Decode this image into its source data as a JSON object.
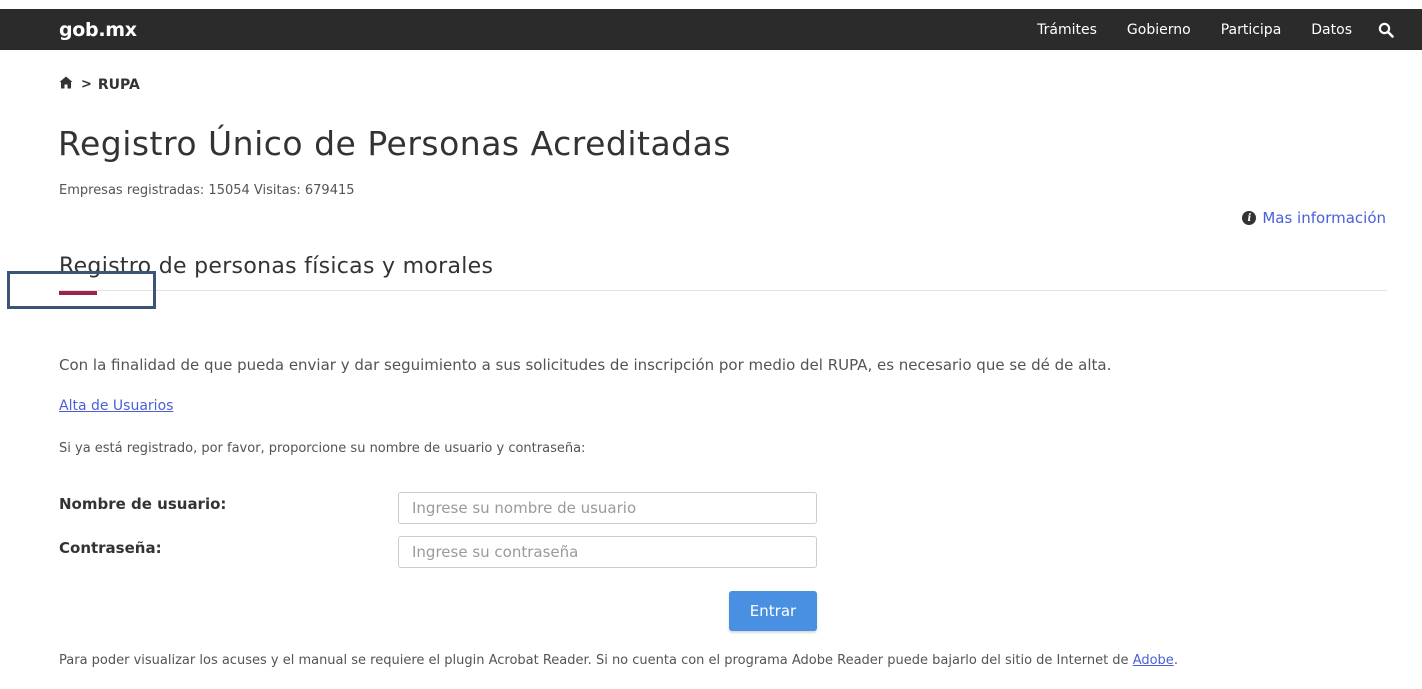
{
  "header": {
    "brand": "gob.mx",
    "nav": [
      {
        "label": "Trámites"
      },
      {
        "label": "Gobierno"
      },
      {
        "label": "Participa"
      },
      {
        "label": "Datos"
      }
    ],
    "search_icon": "search-icon"
  },
  "breadcrumb": {
    "home_icon": "home-icon",
    "separator": ">",
    "current": "RUPA"
  },
  "page": {
    "title": "Registro Único de Personas Acreditadas",
    "stats": "Empresas registradas: 15054 Visitas: 679415",
    "more_info": "Mas información",
    "section_title": "Registro de personas físicas y morales"
  },
  "content": {
    "intro": "Con la finalidad de que pueda enviar y dar seguimiento a sus solicitudes de inscripción por medio del RUPA, es necesario que se dé de alta.",
    "signup_link": "Alta de Usuarios",
    "login_prompt": "Si ya está registrado, por favor, proporcione su nombre de usuario y contraseña:"
  },
  "form": {
    "username_label": "Nombre de usuario:",
    "username_placeholder": "Ingrese su nombre de usuario",
    "username_value": "",
    "password_label": "Contraseña:",
    "password_placeholder": "Ingrese su contraseña",
    "password_value": "",
    "submit_label": "Entrar"
  },
  "footer": {
    "note_text": "Para poder visualizar los acuses y el manual se requiere el plugin Acrobat Reader. Si no cuenta con el programa Adobe Reader puede bajarlo del sitio de Internet de ",
    "note_link": "Adobe",
    "note_end": "."
  },
  "colors": {
    "navbar": "#2b2b2b",
    "accent": "#9d2449",
    "link": "#4a5fd8",
    "button": "#4a90e2",
    "annotation": "#3b5578"
  }
}
